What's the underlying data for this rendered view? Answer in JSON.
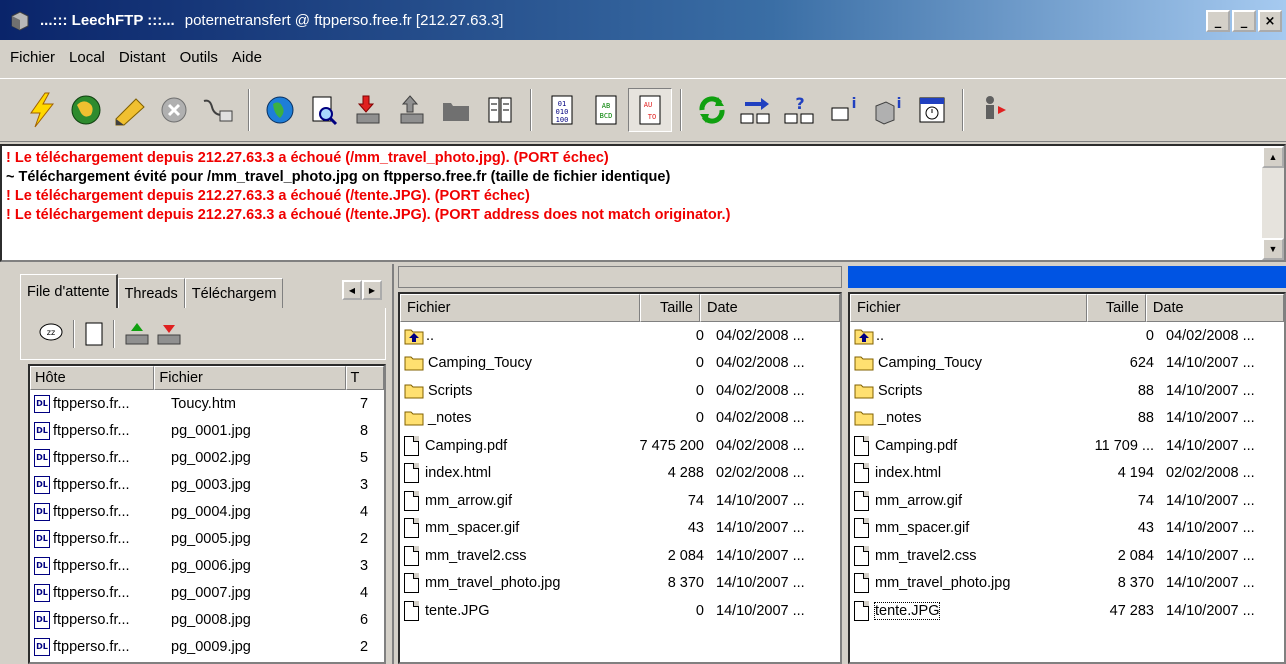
{
  "window": {
    "app_title": "...::: LeechFTP :::...",
    "connection": "poternetransfert @ ftpperso.free.fr [212.27.63.3]",
    "btn_minimize": "_",
    "btn_restore": "_",
    "btn_close": "×"
  },
  "menu": [
    "Fichier",
    "Local",
    "Distant",
    "Outils",
    "Aide"
  ],
  "toolbar": {
    "buttons": [
      "connect-icon",
      "quick-connect-icon",
      "edit-icon",
      "abort-icon",
      "disconnect-icon",
      "site-manager-icon",
      "view-file-icon",
      "download-icon",
      "upload-icon",
      "new-folder-icon",
      "properties-icon",
      "binary-mode-icon",
      "ascii-mode-icon",
      "auto-mode-icon",
      "refresh-icon",
      "transfer-icon",
      "compare-icon",
      "info-icon",
      "disk-info-icon",
      "schedule-icon",
      "exit-icon"
    ]
  },
  "log": [
    {
      "type": "err",
      "text": "! Le téléchargement depuis 212.27.63.3 a échoué (/mm_travel_photo.jpg). (PORT échec)"
    },
    {
      "type": "ok",
      "text": "~ Téléchargement évité pour /mm_travel_photo.jpg on ftpperso.free.fr (taille de fichier identique)"
    },
    {
      "type": "err",
      "text": "! Le téléchargement depuis 212.27.63.3 a échoué (/tente.JPG). (PORT échec)"
    },
    {
      "type": "err",
      "text": "! Le téléchargement depuis 212.27.63.3 a échoué (/tente.JPG). (PORT address does not match originator.)"
    }
  ],
  "queue": {
    "tabs": [
      "File d'attente",
      "Threads",
      "Téléchargem"
    ],
    "columns": [
      "Hôte",
      "Fichier",
      "T"
    ],
    "rows": [
      {
        "host": "ftpperso.fr...",
        "file": "Toucy.htm",
        "t": "7"
      },
      {
        "host": "ftpperso.fr...",
        "file": "pg_0001.jpg",
        "t": "8"
      },
      {
        "host": "ftpperso.fr...",
        "file": "pg_0002.jpg",
        "t": "5"
      },
      {
        "host": "ftpperso.fr...",
        "file": "pg_0003.jpg",
        "t": "3"
      },
      {
        "host": "ftpperso.fr...",
        "file": "pg_0004.jpg",
        "t": "4"
      },
      {
        "host": "ftpperso.fr...",
        "file": "pg_0005.jpg",
        "t": "2"
      },
      {
        "host": "ftpperso.fr...",
        "file": "pg_0006.jpg",
        "t": "3"
      },
      {
        "host": "ftpperso.fr...",
        "file": "pg_0007.jpg",
        "t": "4"
      },
      {
        "host": "ftpperso.fr...",
        "file": "pg_0008.jpg",
        "t": "6"
      },
      {
        "host": "ftpperso.fr...",
        "file": "pg_0009.jpg",
        "t": "2"
      }
    ]
  },
  "local_pane": {
    "columns": [
      "Fichier",
      "Taille",
      "Date"
    ],
    "rows": [
      {
        "kind": "up",
        "name": "..",
        "size": "0",
        "date": "04/02/2008 ..."
      },
      {
        "kind": "folder",
        "name": "Camping_Toucy",
        "size": "0",
        "date": "04/02/2008 ..."
      },
      {
        "kind": "folder",
        "name": "Scripts",
        "size": "0",
        "date": "04/02/2008 ..."
      },
      {
        "kind": "folder",
        "name": "_notes",
        "size": "0",
        "date": "04/02/2008 ..."
      },
      {
        "kind": "file",
        "name": "Camping.pdf",
        "size": "7 475 200",
        "date": "04/02/2008 ..."
      },
      {
        "kind": "file",
        "name": "index.html",
        "size": "4 288",
        "date": "02/02/2008 ..."
      },
      {
        "kind": "file",
        "name": "mm_arrow.gif",
        "size": "74",
        "date": "14/10/2007 ..."
      },
      {
        "kind": "file",
        "name": "mm_spacer.gif",
        "size": "43",
        "date": "14/10/2007 ..."
      },
      {
        "kind": "file",
        "name": "mm_travel2.css",
        "size": "2 084",
        "date": "14/10/2007 ..."
      },
      {
        "kind": "file",
        "name": "mm_travel_photo.jpg",
        "size": "8 370",
        "date": "14/10/2007 ..."
      },
      {
        "kind": "file",
        "name": "tente.JPG",
        "size": "0",
        "date": "14/10/2007 ..."
      }
    ]
  },
  "remote_pane": {
    "columns": [
      "Fichier",
      "Taille",
      "Date"
    ],
    "rows": [
      {
        "kind": "up",
        "name": "..",
        "size": "0",
        "date": "04/02/2008 ..."
      },
      {
        "kind": "folder",
        "name": "Camping_Toucy",
        "size": "624",
        "date": "14/10/2007 ..."
      },
      {
        "kind": "folder",
        "name": "Scripts",
        "size": "88",
        "date": "14/10/2007 ..."
      },
      {
        "kind": "folder",
        "name": "_notes",
        "size": "88",
        "date": "14/10/2007 ..."
      },
      {
        "kind": "file",
        "name": "Camping.pdf",
        "size": "11 709 ...",
        "date": "14/10/2007 ..."
      },
      {
        "kind": "file",
        "name": "index.html",
        "size": "4 194",
        "date": "02/02/2008 ..."
      },
      {
        "kind": "file",
        "name": "mm_arrow.gif",
        "size": "74",
        "date": "14/10/2007 ..."
      },
      {
        "kind": "file",
        "name": "mm_spacer.gif",
        "size": "43",
        "date": "14/10/2007 ..."
      },
      {
        "kind": "file",
        "name": "mm_travel2.css",
        "size": "2 084",
        "date": "14/10/2007 ..."
      },
      {
        "kind": "file",
        "name": "mm_travel_photo.jpg",
        "size": "8 370",
        "date": "14/10/2007 ..."
      },
      {
        "kind": "file",
        "name": "tente.JPG",
        "size": "47 283",
        "date": "14/10/2007 ...",
        "focused": true
      }
    ]
  },
  "colors": {
    "title_gradient_start": "#0a246a",
    "active_pane": "#0054e3",
    "error_text": "#f00000",
    "face": "#d4d0c8"
  }
}
